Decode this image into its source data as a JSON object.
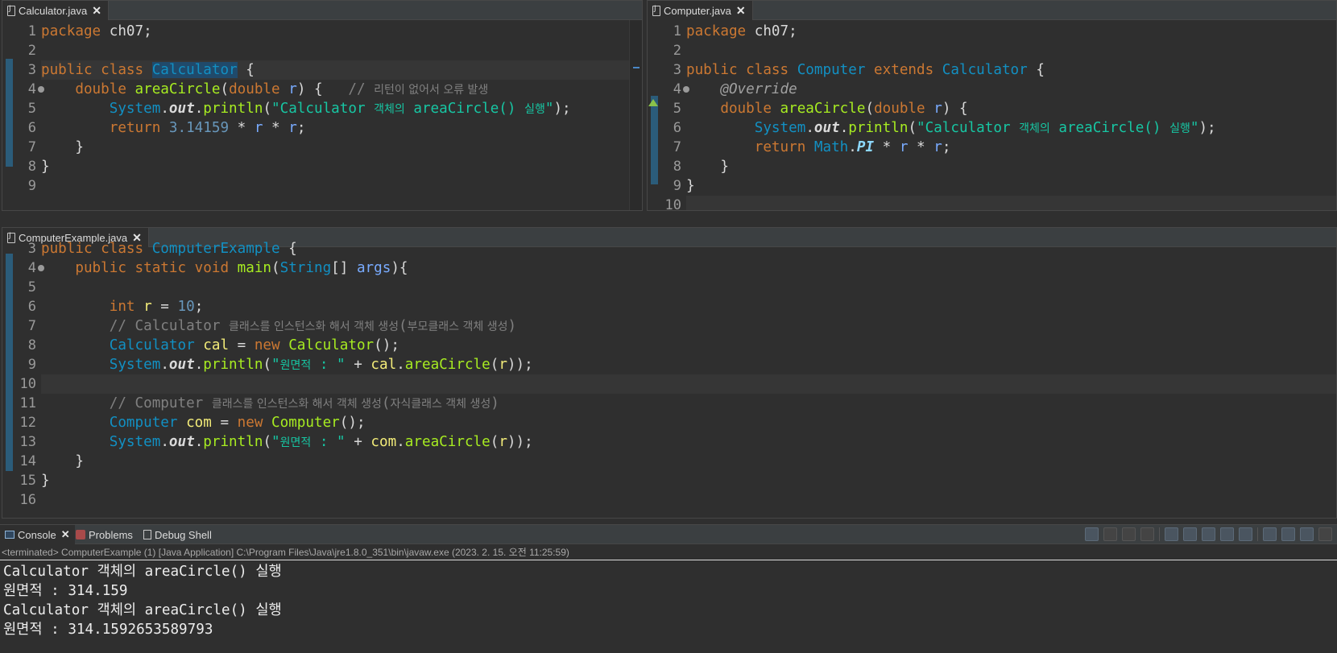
{
  "editors": {
    "calculator": {
      "tab": "Calculator.java",
      "lines": [
        {
          "n": "1",
          "code": [
            {
              "t": "package",
              "c": "kw"
            },
            {
              "t": " ch07;",
              "c": ""
            }
          ]
        },
        {
          "n": "2",
          "code": []
        },
        {
          "n": "3",
          "code": [
            {
              "t": "public class ",
              "c": "kw"
            },
            {
              "t": "Calculator",
              "c": "ty sel"
            },
            {
              "t": " {",
              "c": ""
            }
          ]
        },
        {
          "n": "4",
          "code": [
            {
              "t": "    ",
              "c": ""
            },
            {
              "t": "double ",
              "c": "kw"
            },
            {
              "t": "areaCircle",
              "c": "fn"
            },
            {
              "t": "(",
              "c": ""
            },
            {
              "t": "double ",
              "c": "kw"
            },
            {
              "t": "r",
              "c": "vr"
            },
            {
              "t": ") {   ",
              "c": ""
            },
            {
              "t": "// ",
              "c": "cm"
            },
            {
              "t": "리턴이 없어서 오류 발생",
              "c": "cm kr"
            }
          ]
        },
        {
          "n": "5",
          "code": [
            {
              "t": "        ",
              "c": ""
            },
            {
              "t": "System",
              "c": "ty"
            },
            {
              "t": ".",
              "c": ""
            },
            {
              "t": "out",
              "c": "fd"
            },
            {
              "t": ".",
              "c": ""
            },
            {
              "t": "println",
              "c": "fn"
            },
            {
              "t": "(",
              "c": ""
            },
            {
              "t": "\"Calculator ",
              "c": "st"
            },
            {
              "t": "객체의",
              "c": "st kr"
            },
            {
              "t": " areaCircle() ",
              "c": "st"
            },
            {
              "t": "실행",
              "c": "st kr"
            },
            {
              "t": "\"",
              "c": "st"
            },
            {
              "t": ");",
              "c": ""
            }
          ]
        },
        {
          "n": "6",
          "code": [
            {
              "t": "        ",
              "c": ""
            },
            {
              "t": "return ",
              "c": "kw"
            },
            {
              "t": "3.14159",
              "c": "nm"
            },
            {
              "t": " * ",
              "c": ""
            },
            {
              "t": "r",
              "c": "vr"
            },
            {
              "t": " * ",
              "c": ""
            },
            {
              "t": "r",
              "c": "vr"
            },
            {
              "t": ";",
              "c": ""
            }
          ]
        },
        {
          "n": "7",
          "code": [
            {
              "t": "    }",
              "c": ""
            }
          ]
        },
        {
          "n": "8",
          "code": [
            {
              "t": "}",
              "c": ""
            }
          ]
        },
        {
          "n": "9",
          "code": []
        }
      ]
    },
    "computer": {
      "tab": "Computer.java",
      "lines": [
        {
          "n": "1",
          "code": [
            {
              "t": "package",
              "c": "kw"
            },
            {
              "t": " ch07;",
              "c": ""
            }
          ]
        },
        {
          "n": "2",
          "code": []
        },
        {
          "n": "3",
          "code": [
            {
              "t": "public class ",
              "c": "kw"
            },
            {
              "t": "Computer",
              "c": "ty"
            },
            {
              "t": " extends ",
              "c": "kw"
            },
            {
              "t": "Calculator",
              "c": "ty"
            },
            {
              "t": " {",
              "c": ""
            }
          ]
        },
        {
          "n": "4",
          "code": [
            {
              "t": "    ",
              "c": ""
            },
            {
              "t": "@Override",
              "c": "an"
            }
          ]
        },
        {
          "n": "5",
          "code": [
            {
              "t": "    ",
              "c": ""
            },
            {
              "t": "double ",
              "c": "kw"
            },
            {
              "t": "areaCircle",
              "c": "fn"
            },
            {
              "t": "(",
              "c": ""
            },
            {
              "t": "double ",
              "c": "kw"
            },
            {
              "t": "r",
              "c": "vr"
            },
            {
              "t": ") {",
              "c": ""
            }
          ]
        },
        {
          "n": "6",
          "code": [
            {
              "t": "        ",
              "c": ""
            },
            {
              "t": "System",
              "c": "ty"
            },
            {
              "t": ".",
              "c": ""
            },
            {
              "t": "out",
              "c": "fd"
            },
            {
              "t": ".",
              "c": ""
            },
            {
              "t": "println",
              "c": "fn"
            },
            {
              "t": "(",
              "c": ""
            },
            {
              "t": "\"Calculator ",
              "c": "st"
            },
            {
              "t": "객체의",
              "c": "st kr"
            },
            {
              "t": " areaCircle() ",
              "c": "st"
            },
            {
              "t": "실행",
              "c": "st kr"
            },
            {
              "t": "\"",
              "c": "st"
            },
            {
              "t": ");",
              "c": ""
            }
          ]
        },
        {
          "n": "7",
          "code": [
            {
              "t": "        ",
              "c": ""
            },
            {
              "t": "return ",
              "c": "kw"
            },
            {
              "t": "Math",
              "c": "ty"
            },
            {
              "t": ".",
              "c": ""
            },
            {
              "t": "PI",
              "c": "cn"
            },
            {
              "t": " * ",
              "c": ""
            },
            {
              "t": "r",
              "c": "vr"
            },
            {
              "t": " * ",
              "c": ""
            },
            {
              "t": "r",
              "c": "vr"
            },
            {
              "t": ";",
              "c": ""
            }
          ]
        },
        {
          "n": "8",
          "code": [
            {
              "t": "    }",
              "c": ""
            }
          ]
        },
        {
          "n": "9",
          "code": [
            {
              "t": "}",
              "c": ""
            }
          ]
        },
        {
          "n": "10",
          "code": []
        }
      ]
    },
    "example": {
      "tab": "ComputerExample.java",
      "lines": [
        {
          "n": "3",
          "code": [
            {
              "t": "public class ",
              "c": "kw"
            },
            {
              "t": "ComputerExample",
              "c": "ty"
            },
            {
              "t": " {",
              "c": ""
            }
          ]
        },
        {
          "n": "4",
          "code": [
            {
              "t": "    ",
              "c": ""
            },
            {
              "t": "public static void ",
              "c": "kw"
            },
            {
              "t": "main",
              "c": "fn"
            },
            {
              "t": "(",
              "c": ""
            },
            {
              "t": "String",
              "c": "ty"
            },
            {
              "t": "[] ",
              "c": ""
            },
            {
              "t": "args",
              "c": "vr"
            },
            {
              "t": "){",
              "c": ""
            }
          ]
        },
        {
          "n": "5",
          "code": []
        },
        {
          "n": "6",
          "code": [
            {
              "t": "        ",
              "c": ""
            },
            {
              "t": "int ",
              "c": "kw"
            },
            {
              "t": "r",
              "c": "lv"
            },
            {
              "t": " = ",
              "c": ""
            },
            {
              "t": "10",
              "c": "nm"
            },
            {
              "t": ";",
              "c": ""
            }
          ]
        },
        {
          "n": "7",
          "code": [
            {
              "t": "        ",
              "c": ""
            },
            {
              "t": "// Calculator ",
              "c": "cm"
            },
            {
              "t": "클래스를 인스턴스화 해서 객체 생성",
              "c": "cm kr"
            },
            {
              "t": "(",
              "c": "cm"
            },
            {
              "t": "부모클래스 객체 생성",
              "c": "cm kr"
            },
            {
              "t": ")",
              "c": "cm"
            }
          ]
        },
        {
          "n": "8",
          "code": [
            {
              "t": "        ",
              "c": ""
            },
            {
              "t": "Calculator ",
              "c": "ty"
            },
            {
              "t": "cal",
              "c": "lv"
            },
            {
              "t": " = ",
              "c": ""
            },
            {
              "t": "new ",
              "c": "kw"
            },
            {
              "t": "Calculator",
              "c": "fn"
            },
            {
              "t": "();",
              "c": ""
            }
          ]
        },
        {
          "n": "9",
          "code": [
            {
              "t": "        ",
              "c": ""
            },
            {
              "t": "System",
              "c": "ty"
            },
            {
              "t": ".",
              "c": ""
            },
            {
              "t": "out",
              "c": "fd"
            },
            {
              "t": ".",
              "c": ""
            },
            {
              "t": "println",
              "c": "fn"
            },
            {
              "t": "(",
              "c": ""
            },
            {
              "t": "\"",
              "c": "st"
            },
            {
              "t": "원면적",
              "c": "st kr"
            },
            {
              "t": " : \"",
              "c": "st"
            },
            {
              "t": " + ",
              "c": ""
            },
            {
              "t": "cal",
              "c": "lv"
            },
            {
              "t": ".",
              "c": ""
            },
            {
              "t": "areaCircle",
              "c": "fn"
            },
            {
              "t": "(",
              "c": ""
            },
            {
              "t": "r",
              "c": "lv"
            },
            {
              "t": "));",
              "c": ""
            }
          ]
        },
        {
          "n": "10",
          "code": []
        },
        {
          "n": "11",
          "code": [
            {
              "t": "        ",
              "c": ""
            },
            {
              "t": "// Computer ",
              "c": "cm"
            },
            {
              "t": "클래스를 인스턴스화 해서 객체 생성",
              "c": "cm kr"
            },
            {
              "t": "(",
              "c": "cm"
            },
            {
              "t": "자식클래스 객체 생성",
              "c": "cm kr"
            },
            {
              "t": ")",
              "c": "cm"
            }
          ]
        },
        {
          "n": "12",
          "code": [
            {
              "t": "        ",
              "c": ""
            },
            {
              "t": "Computer ",
              "c": "ty"
            },
            {
              "t": "com",
              "c": "lv"
            },
            {
              "t": " = ",
              "c": ""
            },
            {
              "t": "new ",
              "c": "kw"
            },
            {
              "t": "Computer",
              "c": "fn"
            },
            {
              "t": "();",
              "c": ""
            }
          ]
        },
        {
          "n": "13",
          "code": [
            {
              "t": "        ",
              "c": ""
            },
            {
              "t": "System",
              "c": "ty"
            },
            {
              "t": ".",
              "c": ""
            },
            {
              "t": "out",
              "c": "fd"
            },
            {
              "t": ".",
              "c": ""
            },
            {
              "t": "println",
              "c": "fn"
            },
            {
              "t": "(",
              "c": ""
            },
            {
              "t": "\"",
              "c": "st"
            },
            {
              "t": "원면적",
              "c": "st kr"
            },
            {
              "t": " : \"",
              "c": "st"
            },
            {
              "t": " + ",
              "c": ""
            },
            {
              "t": "com",
              "c": "lv"
            },
            {
              "t": ".",
              "c": ""
            },
            {
              "t": "areaCircle",
              "c": "fn"
            },
            {
              "t": "(",
              "c": ""
            },
            {
              "t": "r",
              "c": "lv"
            },
            {
              "t": "));",
              "c": ""
            }
          ]
        },
        {
          "n": "14",
          "code": [
            {
              "t": "    }",
              "c": ""
            }
          ]
        },
        {
          "n": "15",
          "code": [
            {
              "t": "}",
              "c": ""
            }
          ]
        },
        {
          "n": "16",
          "code": []
        }
      ]
    }
  },
  "console": {
    "tabs": [
      "Console",
      "Problems",
      "Debug Shell"
    ],
    "status": "<terminated> ComputerExample (1) [Java Application] C:\\Program Files\\Java\\jre1.8.0_351\\bin\\javaw.exe (2023. 2. 15. 오전 11:25:59)",
    "output": [
      "Calculator 객체의 areaCircle() 실행",
      "원면적 : 314.159",
      "Calculator 객체의 areaCircle() 실행",
      "원면적 : 314.1592653589793"
    ]
  },
  "colors": {
    "keyword": "#cc7832",
    "type": "#1290c3",
    "method": "#a7ec21",
    "string": "#17c6a3",
    "background": "#2f2f2f"
  }
}
